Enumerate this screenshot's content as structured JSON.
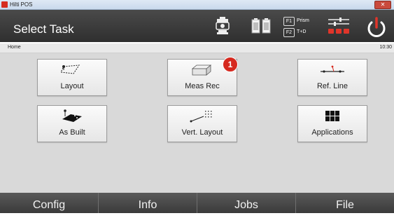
{
  "window": {
    "title": "Hilti POS",
    "close_glyph": "✕"
  },
  "header": {
    "title": "Select Task",
    "icons": [
      "surveyor-instrument-icon",
      "battery-icon",
      "settings-sliders-icon",
      "power-icon"
    ],
    "fkeys": [
      {
        "key": "F1",
        "label": "Prism"
      },
      {
        "key": "F2",
        "label": "T+D"
      }
    ]
  },
  "breadcrumb": {
    "path": "Home",
    "time": "10:30"
  },
  "tiles": [
    {
      "label": "Layout",
      "icon": "layout-icon"
    },
    {
      "label": "Meas Rec",
      "icon": "meas-rec-icon",
      "badge": "1"
    },
    {
      "label": "Ref. Line",
      "icon": "ref-line-icon"
    },
    {
      "label": "As Built",
      "icon": "as-built-icon"
    },
    {
      "label": "Vert. Layout",
      "icon": "vert-layout-icon"
    },
    {
      "label": "Applications",
      "icon": "applications-grid-icon"
    }
  ],
  "nav": {
    "items": [
      "Config",
      "Info",
      "Jobs",
      "File"
    ]
  },
  "colors": {
    "accent_red": "#d6291f",
    "header_bg": "#3a3a3a",
    "content_bg": "#d9d9d9"
  }
}
